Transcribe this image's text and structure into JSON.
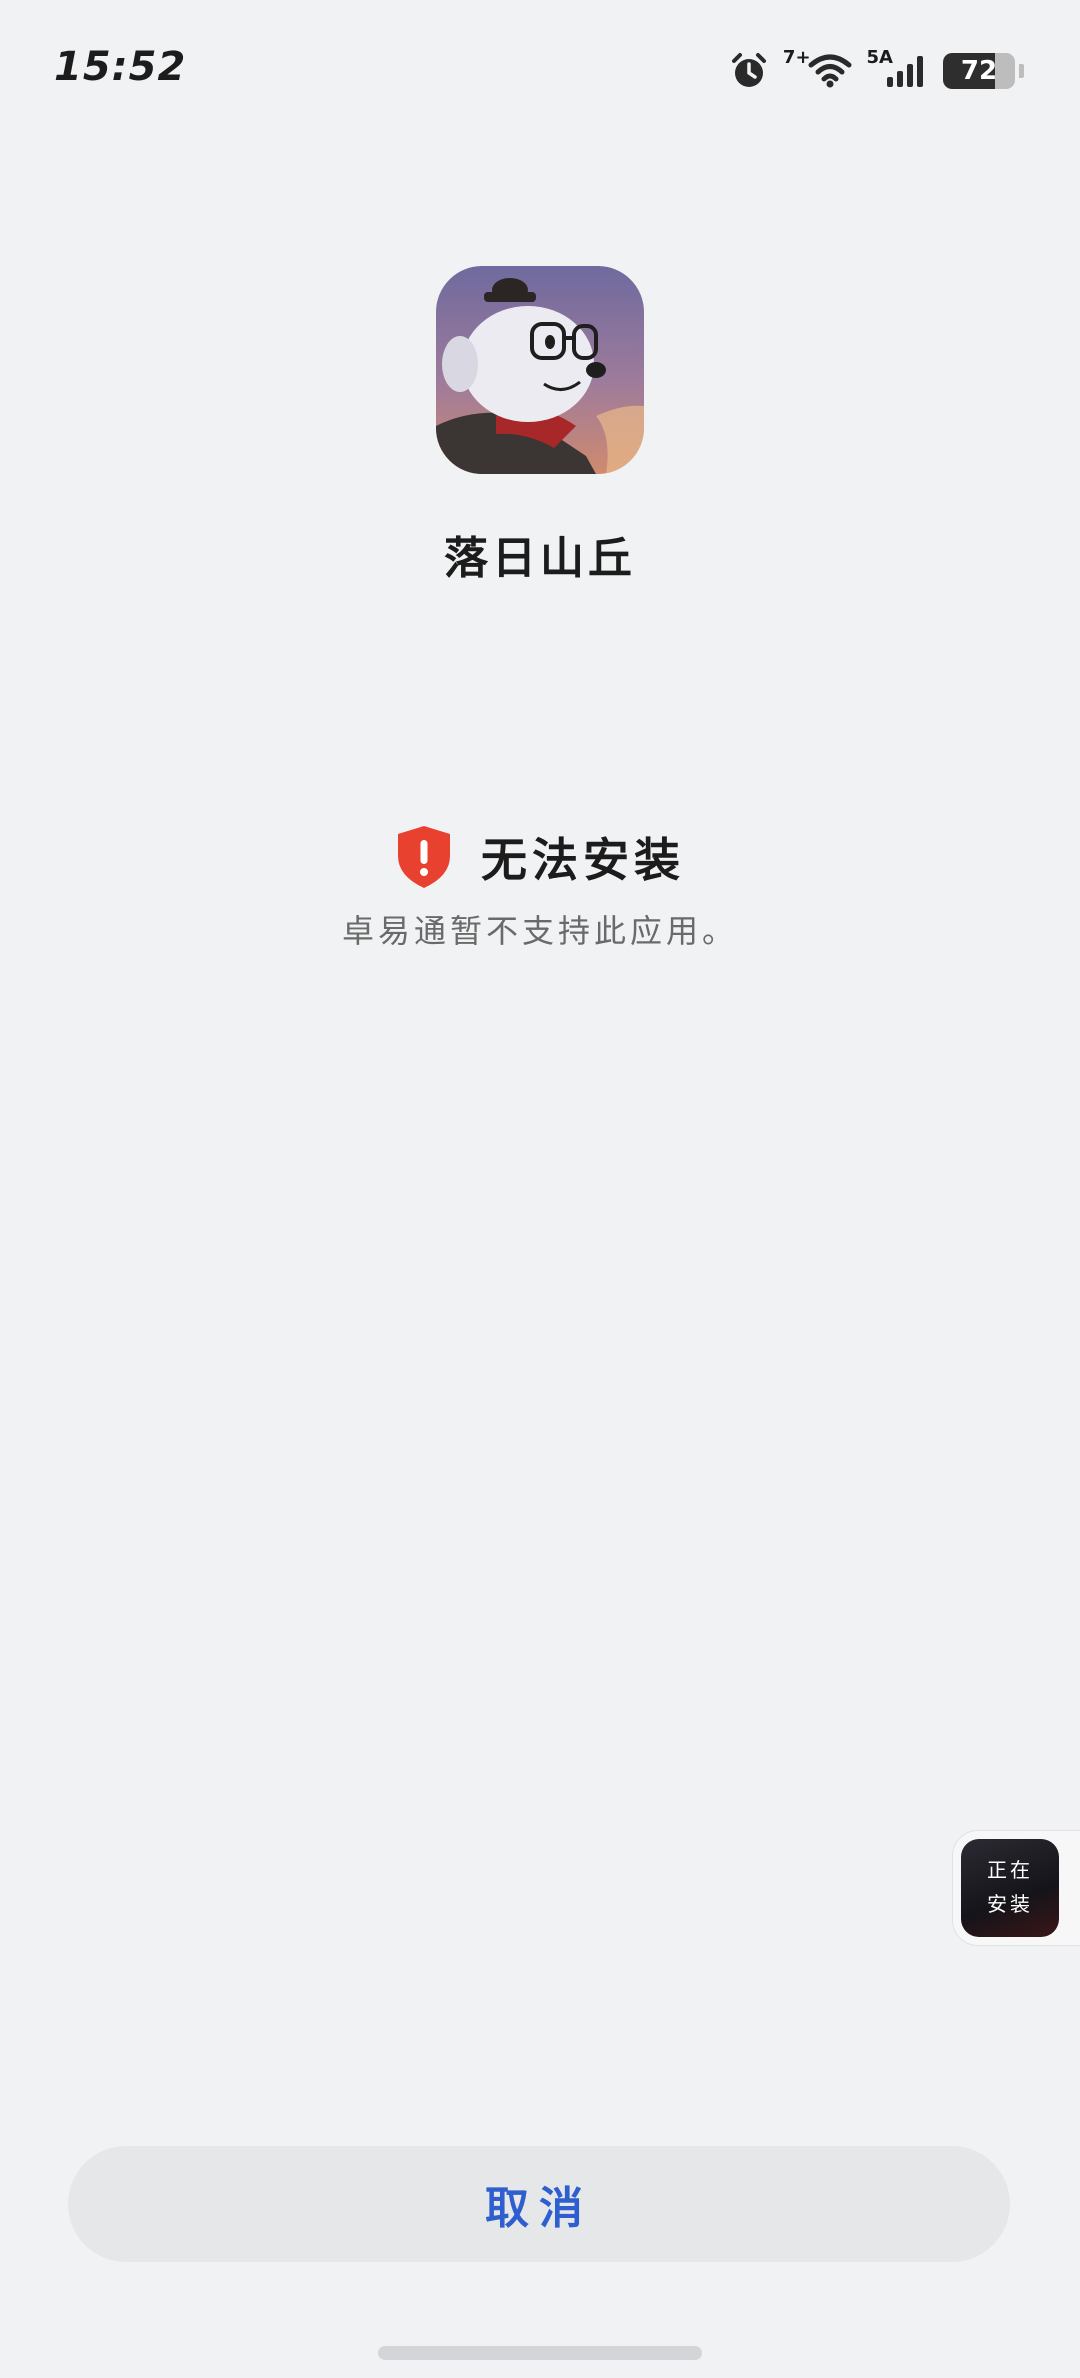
{
  "status_bar": {
    "time": "15:52",
    "network_label": "7+",
    "mobile_label": "5A",
    "battery_level": 72,
    "battery_text": "72"
  },
  "app": {
    "name": "落日山丘"
  },
  "error": {
    "title": "无法安装",
    "description": "卓易通暂不支持此应用。",
    "icon": "shield-alert-icon",
    "color": "#e8412f"
  },
  "floating_widget": {
    "line1": "正在",
    "line2": "安装"
  },
  "actions": {
    "cancel_label": "取消",
    "accent_color": "#2f5fce"
  }
}
